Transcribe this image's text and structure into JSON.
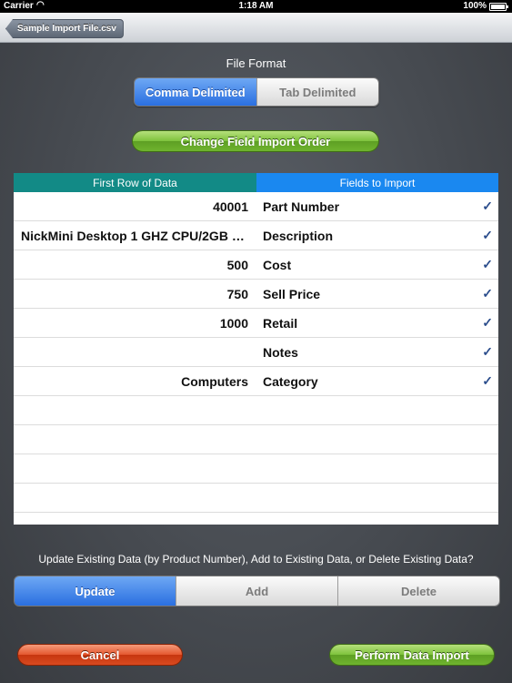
{
  "status_bar": {
    "carrier": "Carrier",
    "time": "1:18 AM",
    "battery": "100%"
  },
  "nav": {
    "back_label": "Sample Import File.csv"
  },
  "file_format": {
    "label": "File Format",
    "options": [
      "Comma Delimited",
      "Tab Delimited"
    ],
    "selected": "Comma Delimited"
  },
  "change_order_label": "Change Field Import Order",
  "table": {
    "headers": [
      "First Row of Data",
      "Fields to Import"
    ],
    "rows": [
      {
        "value": "40001",
        "field": "Part Number",
        "check": "✓"
      },
      {
        "value": "NickMini Desktop 1 GHZ CPU/2GB RAM",
        "field": "Description",
        "check": "✓"
      },
      {
        "value": "500",
        "field": "Cost",
        "check": "✓"
      },
      {
        "value": "750",
        "field": "Sell Price",
        "check": "✓"
      },
      {
        "value": "1000",
        "field": "Retail",
        "check": "✓"
      },
      {
        "value": "",
        "field": "Notes",
        "check": "✓"
      },
      {
        "value": "Computers",
        "field": "Category",
        "check": "✓"
      }
    ]
  },
  "question": "Update Existing Data (by Product Number), Add to Existing Data, or Delete Existing Data?",
  "mode": {
    "options": [
      "Update",
      "Add",
      "Delete"
    ],
    "selected": "Update"
  },
  "buttons": {
    "cancel": "Cancel",
    "perform": "Perform Data Import"
  },
  "colors": {
    "header_left": "#128a86",
    "header_right": "#1a88f0",
    "selected_segment": "#2a6fe0",
    "green_button": "#6fb42e",
    "red_button": "#d84a20"
  }
}
